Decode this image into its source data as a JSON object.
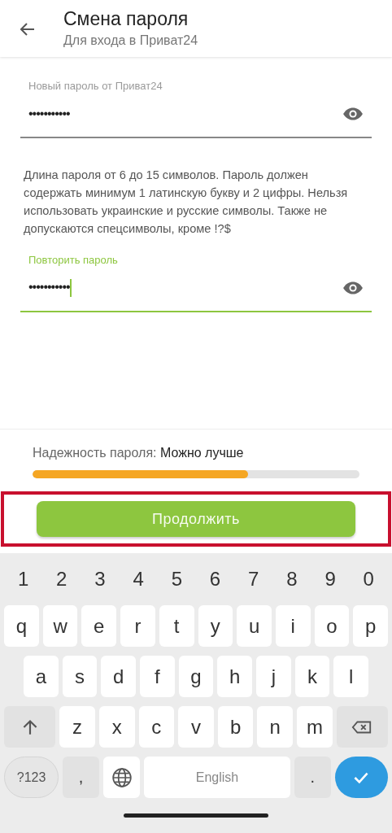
{
  "header": {
    "title": "Смена пароля",
    "subtitle": "Для входа в Приват24"
  },
  "fields": [
    {
      "label": "Новый пароль от Приват24",
      "value": "•••••••••••",
      "focused": false
    },
    {
      "label": "Повторить пароль",
      "value": "•••••••••••",
      "focused": true
    }
  ],
  "hint": "Длина пароля от 6 до 15 символов. Пароль должен содержать минимум 1 латинскую букву и 2 цифры. Нельзя использовать украинские и русские символы. Также не допускаются спецсимволы, кроме !?$",
  "strength": {
    "label": "Надежность пароля:",
    "value": "Можно лучше",
    "level": 0.66
  },
  "continue_button": {
    "label": "Продолжить",
    "highlighted": true
  },
  "keyboard": {
    "number_row": [
      "1",
      "2",
      "3",
      "4",
      "5",
      "6",
      "7",
      "8",
      "9",
      "0"
    ],
    "rows": [
      {
        "keys": [
          {
            "kind": "char",
            "label": "q"
          },
          {
            "kind": "char",
            "label": "w"
          },
          {
            "kind": "char",
            "label": "e"
          },
          {
            "kind": "char",
            "label": "r"
          },
          {
            "kind": "char",
            "label": "t"
          },
          {
            "kind": "char",
            "label": "y"
          },
          {
            "kind": "char",
            "label": "u"
          },
          {
            "kind": "char",
            "label": "i"
          },
          {
            "kind": "char",
            "label": "o"
          },
          {
            "kind": "char",
            "label": "p"
          }
        ]
      },
      {
        "keys": [
          {
            "kind": "char",
            "label": "a"
          },
          {
            "kind": "char",
            "label": "s"
          },
          {
            "kind": "char",
            "label": "d"
          },
          {
            "kind": "char",
            "label": "f"
          },
          {
            "kind": "char",
            "label": "g"
          },
          {
            "kind": "char",
            "label": "h"
          },
          {
            "kind": "char",
            "label": "j"
          },
          {
            "kind": "char",
            "label": "k"
          },
          {
            "kind": "char",
            "label": "l"
          }
        ]
      },
      {
        "keys": [
          {
            "kind": "shift"
          },
          {
            "kind": "char",
            "label": "z"
          },
          {
            "kind": "char",
            "label": "x"
          },
          {
            "kind": "char",
            "label": "c"
          },
          {
            "kind": "char",
            "label": "v"
          },
          {
            "kind": "char",
            "label": "b"
          },
          {
            "kind": "char",
            "label": "n"
          },
          {
            "kind": "char",
            "label": "m"
          },
          {
            "kind": "backspace"
          }
        ]
      },
      {
        "keys": [
          {
            "kind": "symbols",
            "label": "?123"
          },
          {
            "kind": "punct",
            "label": ","
          },
          {
            "kind": "globe"
          },
          {
            "kind": "space",
            "label": "English"
          },
          {
            "kind": "punct",
            "label": "."
          },
          {
            "kind": "enter"
          }
        ]
      }
    ]
  }
}
